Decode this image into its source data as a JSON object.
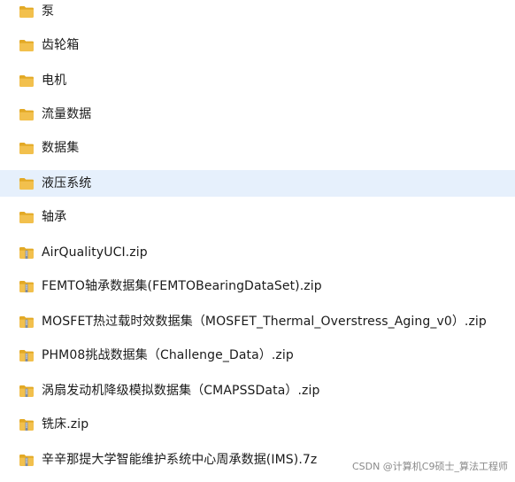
{
  "colors": {
    "folder": "#f2c04d",
    "folder_dark": "#e3a925",
    "zip_band": "#7c8aa5",
    "selected_row": "#e6f0fc"
  },
  "items": [
    {
      "name": "泵",
      "type": "folder",
      "icon": "folder-icon"
    },
    {
      "name": "齿轮箱",
      "type": "folder",
      "icon": "folder-icon"
    },
    {
      "name": "电机",
      "type": "folder",
      "icon": "folder-icon"
    },
    {
      "name": "流量数据",
      "type": "folder",
      "icon": "folder-icon"
    },
    {
      "name": "数据集",
      "type": "folder",
      "icon": "folder-icon"
    },
    {
      "name": "液压系统",
      "type": "folder",
      "icon": "folder-icon",
      "selected": true
    },
    {
      "name": "轴承",
      "type": "folder",
      "icon": "folder-icon"
    },
    {
      "name": "AirQualityUCI.zip",
      "type": "zip",
      "icon": "zip-folder-icon"
    },
    {
      "name": "FEMTO轴承数据集(FEMTOBearingDataSet).zip",
      "type": "zip",
      "icon": "zip-folder-icon"
    },
    {
      "name": "MOSFET热过载时效数据集（MOSFET_Thermal_Overstress_Aging_v0）.zip",
      "type": "zip",
      "icon": "zip-folder-icon"
    },
    {
      "name": "PHM08挑战数据集（Challenge_Data）.zip",
      "type": "zip",
      "icon": "zip-folder-icon"
    },
    {
      "name": "涡扇发动机降级模拟数据集（CMAPSSData）.zip",
      "type": "zip",
      "icon": "zip-folder-icon"
    },
    {
      "name": "铣床.zip",
      "type": "zip",
      "icon": "zip-folder-icon"
    },
    {
      "name": "辛辛那提大学智能维护系统中心周承数据(IMS).7z",
      "type": "zip",
      "icon": "zip-folder-icon"
    }
  ],
  "watermark": "CSDN @计算机C9硕士_算法工程师"
}
